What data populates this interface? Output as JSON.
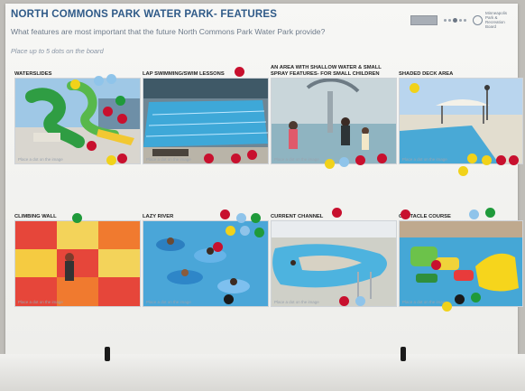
{
  "header": {
    "title": "NORTH COMMONS PARK WATER PARK- FEATURES",
    "question": "What features are most important that the future North Commons Park Water Park provide?",
    "instruction": "Place up to 5 dots on the board",
    "logo_text": "Minneapolis Park & Recreation Board"
  },
  "colors": {
    "title": "#2f5a88",
    "dot_red": "#c8102e",
    "dot_yellow": "#f1d21a",
    "dot_green": "#1f9a3a",
    "dot_blue": "#8fc4ea"
  },
  "tiles": [
    {
      "label": "WATERSLIDES",
      "caption": "Place a dot on the image"
    },
    {
      "label": "LAP SWIMMING/SWIM LESSONS",
      "caption": "Place a dot on the image"
    },
    {
      "label": "AN AREA WITH SHALLOW WATER & SMALL SPRAY FEATURES- FOR SMALL CHILDREN",
      "caption": "Place a dot on the image"
    },
    {
      "label": "SHADED DECK AREA",
      "caption": "Place a dot on the image"
    },
    {
      "label": "CLIMBING WALL",
      "caption": "Place a dot on the image"
    },
    {
      "label": "LAZY RIVER",
      "caption": "Place a dot on the image"
    },
    {
      "label": "CURRENT CHANNEL",
      "caption": "Place a dot on the image"
    },
    {
      "label": "OBSTACLE COURSE",
      "caption": "Place a dot on the image"
    }
  ]
}
